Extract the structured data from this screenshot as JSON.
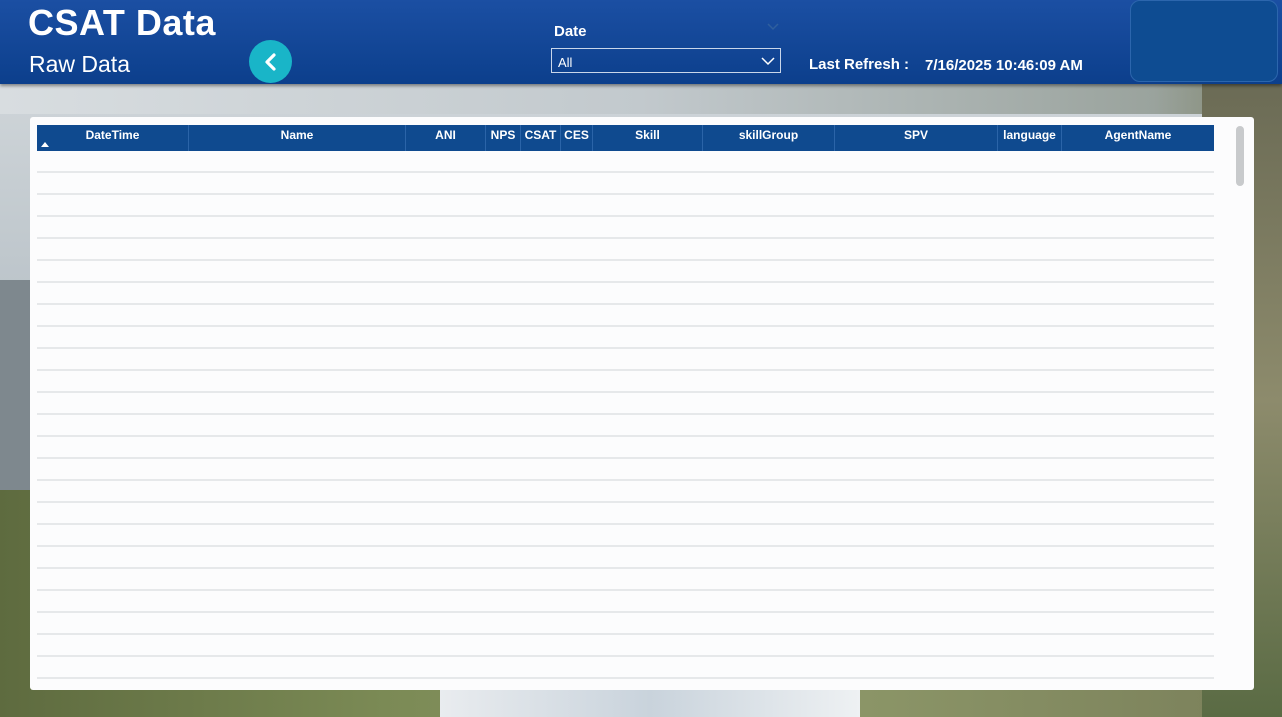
{
  "header": {
    "title": "CSAT Data",
    "subtitle": "Raw Data",
    "date_filter": {
      "label": "Date",
      "selected": "All"
    },
    "refresh": {
      "label": "Last Refresh :",
      "value": "7/16/2025 10:46:09 AM"
    }
  },
  "table": {
    "columns": [
      "DateTime",
      "Name",
      "ANI",
      "NPS",
      "CSAT",
      "CES",
      "Skill",
      "skillGroup",
      "SPV",
      "language",
      "AgentName"
    ],
    "sort": {
      "column": "DateTime",
      "direction": "ascending"
    },
    "rows": []
  },
  "colors": {
    "header_bg": "#0c3f8c",
    "table_header_bg": "#0f4a8f",
    "accent_button": "#19b5c8"
  },
  "icons": {
    "back": "chevron-left-icon",
    "dropdown": "chevron-down-icon",
    "sort": "sort-ascending-icon"
  }
}
